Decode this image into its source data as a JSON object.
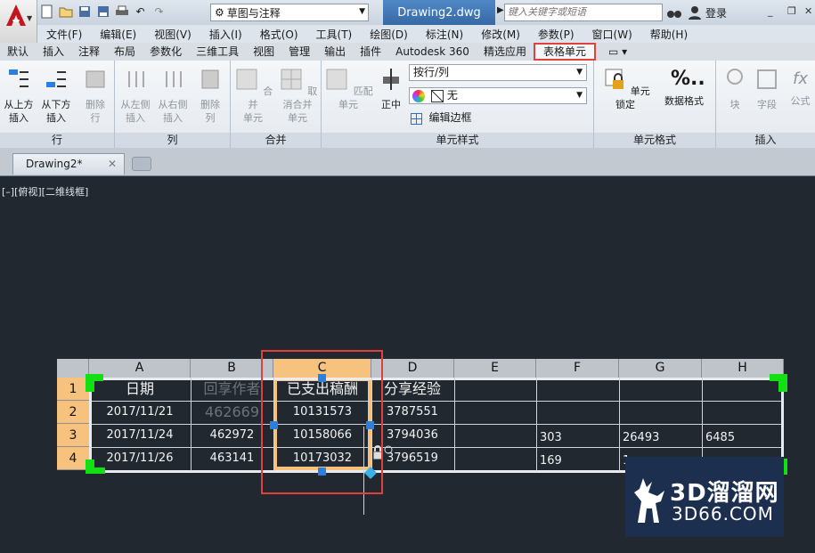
{
  "titlebar": {
    "workspace": "草图与注释",
    "document": "Drawing2.dwg",
    "search_placeholder": "键入关键字或短语",
    "login": "登录"
  },
  "menu": [
    "文件(F)",
    "编辑(E)",
    "视图(V)",
    "插入(I)",
    "格式(O)",
    "工具(T)",
    "绘图(D)",
    "标注(N)",
    "修改(M)",
    "参数(P)",
    "窗口(W)",
    "帮助(H)"
  ],
  "tabs": [
    "默认",
    "插入",
    "注释",
    "布局",
    "参数化",
    "三维工具",
    "视图",
    "管理",
    "输出",
    "插件",
    "Autodesk 360",
    "精选应用",
    "表格单元"
  ],
  "active_tab": "表格单元",
  "ribbon": {
    "row": {
      "title": "行",
      "above": "从上方\n插入",
      "below": "从下方\n插入",
      "delete": "删除\n行"
    },
    "col": {
      "title": "列",
      "left": "从左侧\n插入",
      "right": "从右侧\n插入",
      "delete": "删除\n列"
    },
    "merge": {
      "title": "合并",
      "merge": "合并\n单元",
      "unmerge": "取消合并\n单元"
    },
    "style": {
      "title": "单元样式",
      "match": "匹配单元",
      "align": "正中",
      "row_col": "按行/列",
      "none": "无",
      "edit_border": "编辑边框"
    },
    "format": {
      "title": "单元格式",
      "lock": "单元锁定",
      "data_format": "数据格式"
    },
    "insert": {
      "title": "插入",
      "block": "块",
      "field": "字段",
      "formula": "公式"
    }
  },
  "doc_tab": "Drawing2*",
  "view_label": "[–][俯视][二维线框]",
  "table": {
    "columns": [
      "A",
      "B",
      "C",
      "D",
      "E",
      "F",
      "G",
      "H"
    ],
    "rows": [
      {
        "num": "1",
        "cells": [
          "日期",
          "回享作者",
          "已支出稿酬",
          "分享经验",
          "",
          "",
          "",
          ""
        ]
      },
      {
        "num": "2",
        "cells": [
          "2017/11/21",
          "462669",
          "10131573",
          "3787551",
          "",
          "",
          "",
          ""
        ]
      },
      {
        "num": "3",
        "cells": [
          "2017/11/24",
          "462972",
          "10158066",
          "3794036",
          "",
          "303",
          "26493",
          "6485"
        ]
      },
      {
        "num": "4",
        "cells": [
          "2017/11/26",
          "463141",
          "10173032",
          "3796519",
          "",
          "169",
          "1",
          ""
        ]
      }
    ]
  },
  "watermark": {
    "brand": "3D溜溜网",
    "site": "3D66.COM"
  },
  "colors": {
    "canvas": "#212830",
    "selection": "#f5c27e",
    "grip": "#2a7fe0",
    "corner": "#12e012",
    "highlight": "#e0413a"
  }
}
